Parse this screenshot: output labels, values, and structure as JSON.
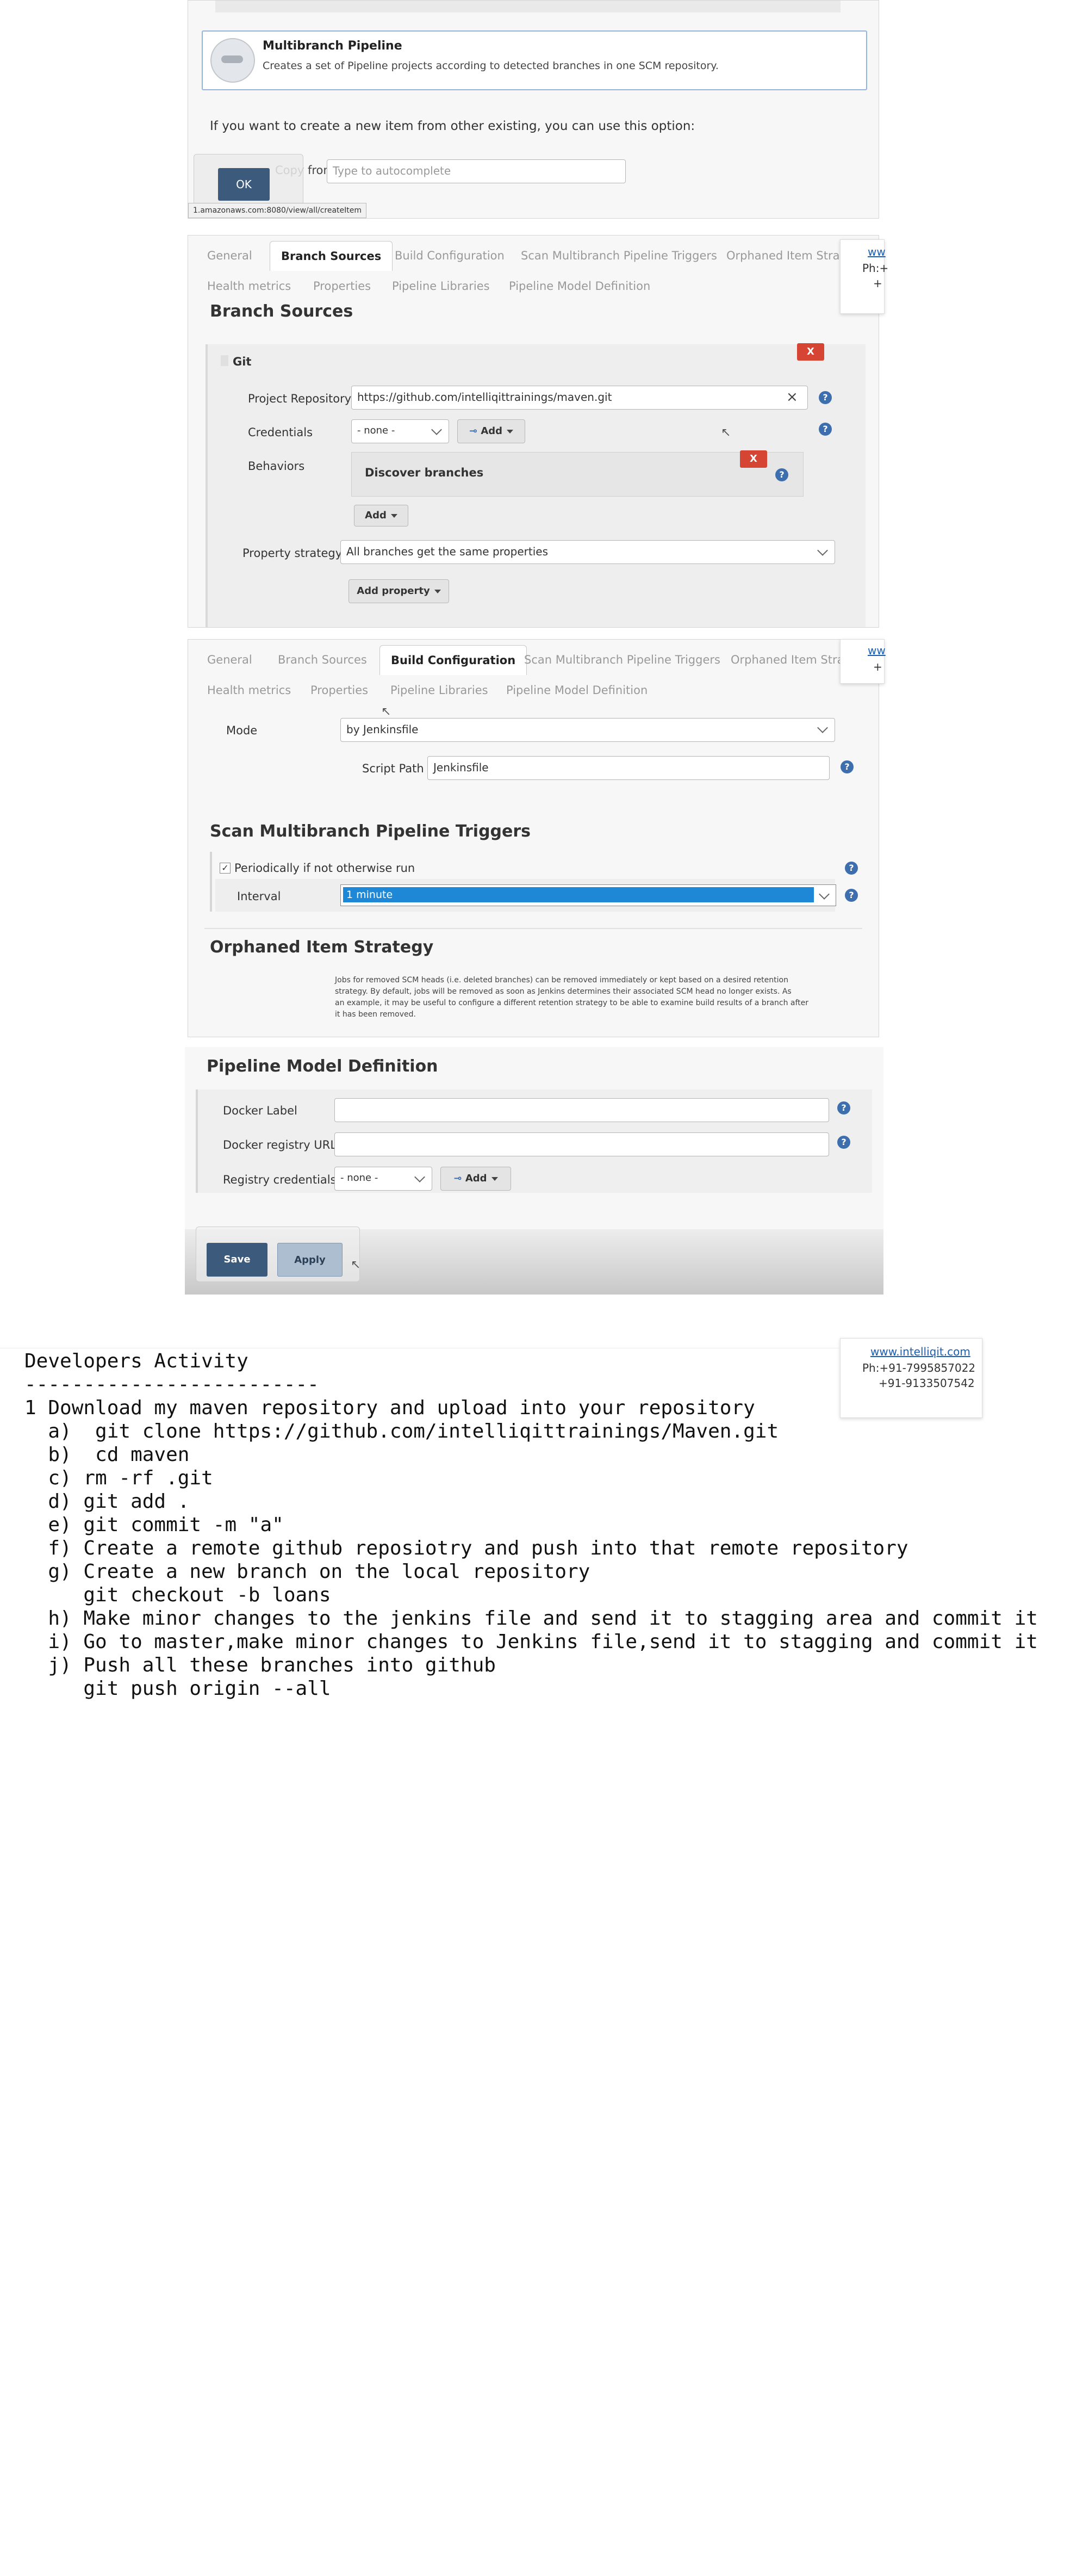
{
  "create_item": {
    "multibranch_title": "Multibranch Pipeline",
    "multibranch_desc": "Creates a set of Pipeline projects according to detected branches in one SCM repository.",
    "copy_hint": "If you want to create a new item from other existing, you can use this option:",
    "copy_from_label": "Copy from",
    "copy_from_placeholder": "Type to autocomplete",
    "ok_label": "OK",
    "status_url": "1.amazonaws.com:8080/view/all/createItem"
  },
  "config_tabs": [
    "General",
    "Branch Sources",
    "Build Configuration",
    "Scan Multibranch Pipeline Triggers",
    "Orphaned Item Strate"
  ],
  "config_tabs_row2": [
    "Health metrics",
    "Properties",
    "Pipeline Libraries",
    "Pipeline Model Definition"
  ],
  "branch_sources": {
    "title": "Branch Sources",
    "git_label": "Git",
    "project_repo_label": "Project Repository",
    "project_repo_value": "https://github.com/intelliqittrainings/maven.git",
    "credentials_label": "Credentials",
    "credentials_value": "- none -",
    "add_label": "Add",
    "behaviors_label": "Behaviors",
    "discover_branches": "Discover branches",
    "add_behavior_label": "Add",
    "property_strategy_label": "Property strategy",
    "property_strategy_value": "All branches get the same properties",
    "add_property_label": "Add property",
    "delete_label": "X",
    "help_label": "?"
  },
  "build_config": {
    "mode_label": "Mode",
    "mode_value": "by Jenkinsfile",
    "script_path_label": "Script Path",
    "script_path_value": "Jenkinsfile",
    "scan_title": "Scan Multibranch Pipeline Triggers",
    "periodic_label": "Periodically if not otherwise run",
    "interval_label": "Interval",
    "interval_value": "1 minute",
    "orphan_title": "Orphaned Item Strategy",
    "orphan_text": [
      "Jobs for removed SCM heads (i.e. deleted branches) can be removed immediately or kept based on a desired retention",
      "strategy. By default, jobs will be removed as soon as Jenkins determines their associated SCM head no longer exists. As",
      "an example, it may be useful to configure a different retention strategy to be able to examine build results of a branch after",
      "it has been removed."
    ]
  },
  "pipeline_model": {
    "title": "Pipeline Model Definition",
    "docker_label": "Docker Label",
    "registry_url_label": "Docker registry URL",
    "registry_cred_label": "Registry credentials",
    "registry_cred_value": "- none -",
    "add_label": "Add",
    "save_label": "Save",
    "apply_label": "Apply"
  },
  "contact": {
    "link": "www.intelliqit.com",
    "phone1": "Ph:+91-7995857022",
    "phone2": "+91-9133507542",
    "link_partial": "ww",
    "phone_partial": "Ph:+",
    "phone2_partial": "+"
  },
  "notes": {
    "title": "Developers Activity",
    "underline": "-------------------------",
    "lines": [
      "1 Download my maven repository and upload into your repository",
      "  a)  git clone https://github.com/intelliqittrainings/Maven.git",
      "  b)  cd maven",
      "  c) rm -rf .git",
      "  d) git add .",
      "  e) git commit -m \"a\"",
      "  f) Create a remote github reposiotry and push into that remote repository",
      "  g) Create a new branch on the local repository",
      "     git checkout -b loans",
      "  h) Make minor changes to the jenkins file and send it to stagging area and commit it",
      "  i) Go to master,make minor changes to Jenkins file,send it to stagging and commit it",
      "  j) Push all these branches into github",
      "     git push origin --all"
    ]
  },
  "colors": {
    "accent": "#3d6fae",
    "danger": "#d64534",
    "selected": "#1e88d6",
    "save_button": "#3c5b7c"
  }
}
